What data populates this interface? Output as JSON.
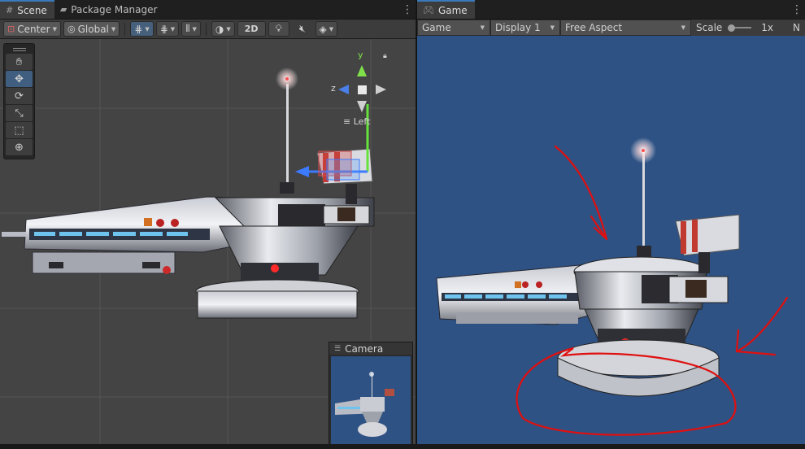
{
  "scene_panel": {
    "tabs": [
      {
        "label": "Scene",
        "icon": "grid-icon"
      },
      {
        "label": "Package Manager",
        "icon": "package-icon"
      }
    ],
    "toolbar": {
      "pivot_mode": "Center",
      "pivot_rotation": "Global",
      "mode_2d": "2D"
    },
    "tools": [
      "hand-tool",
      "move-tool",
      "rotate-tool",
      "scale-tool",
      "rect-tool",
      "transform-tool"
    ],
    "gizmo": {
      "y": "y",
      "z": "z",
      "view_label": "Left"
    },
    "camera_preview": {
      "title": "Camera"
    }
  },
  "game_panel": {
    "tabs": [
      {
        "label": "Game",
        "icon": "gamepad-icon"
      }
    ],
    "toolbar": {
      "view": "Game",
      "display": "Display 1",
      "aspect": "Free Aspect",
      "scale_label": "Scale",
      "scale_value": "1x",
      "overflow_text": "N"
    },
    "annotation_color": "#e01010"
  },
  "colors": {
    "scene_bg": "#444444",
    "game_bg": "#2f5284",
    "accent": "#3a79bb"
  }
}
